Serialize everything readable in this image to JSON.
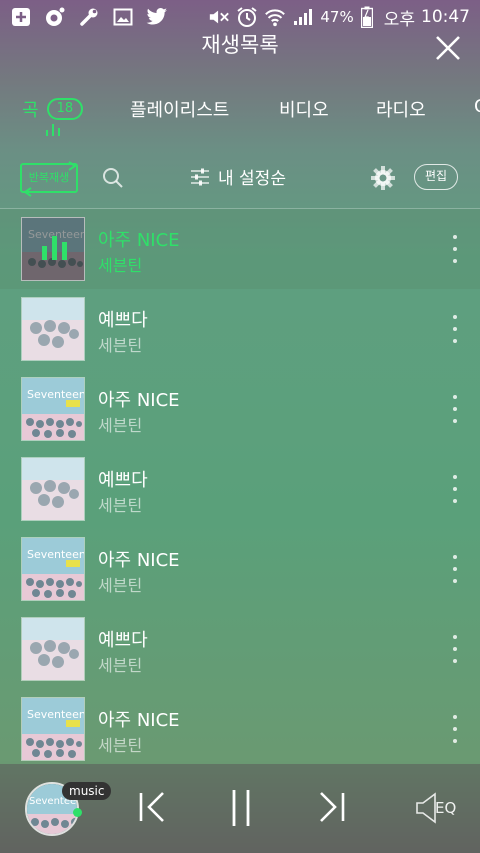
{
  "status": {
    "battery": "47%",
    "ampm": "오후",
    "time": "10:47"
  },
  "header": {
    "title": "재생목록"
  },
  "tabs": [
    {
      "label": "곡",
      "count": "18"
    },
    {
      "label": "플레이리스트"
    },
    {
      "label": "비디오"
    },
    {
      "label": "라디오"
    },
    {
      "label": "C"
    }
  ],
  "toolbar": {
    "repeat_label": "반복재생",
    "sort_label": "내 설정순",
    "edit_label": "편집"
  },
  "songs": [
    {
      "title": "아주 NICE",
      "artist": "세븐틴",
      "current": true
    },
    {
      "title": "예쁘다",
      "artist": "세븐틴"
    },
    {
      "title": "아주 NICE",
      "artist": "세븐틴"
    },
    {
      "title": "예쁘다",
      "artist": "세븐틴"
    },
    {
      "title": "아주 NICE",
      "artist": "세븐틴"
    },
    {
      "title": "예쁘다",
      "artist": "세븐틴"
    },
    {
      "title": "아주 NICE",
      "artist": "세븐틴"
    }
  ],
  "player": {
    "tag": "music",
    "eq_label": "EQ"
  },
  "colors": {
    "accent": "#2fe069"
  }
}
